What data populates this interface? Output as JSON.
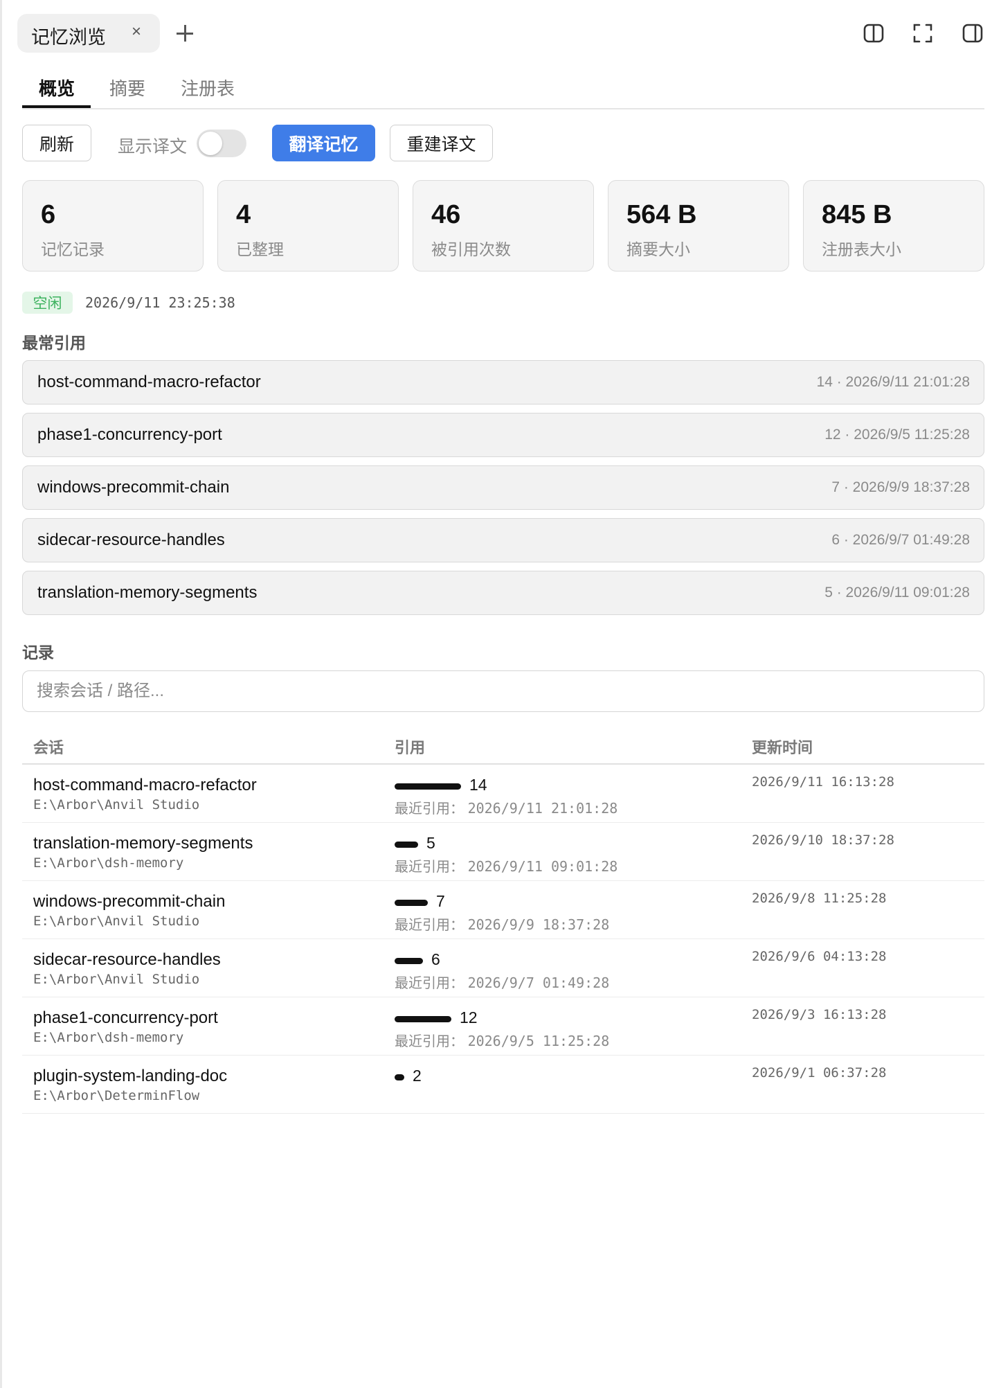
{
  "tab": {
    "label": "记忆浏览",
    "close": "×"
  },
  "nav": [
    "概览",
    "摘要",
    "注册表"
  ],
  "toolbar": {
    "refresh": "刷新",
    "show_translation": "显示译文",
    "translate": "翻译记忆",
    "rebuild": "重建译文",
    "toggle_on": false
  },
  "stats": [
    {
      "value": "6",
      "label": "记忆记录"
    },
    {
      "value": "4",
      "label": "已整理"
    },
    {
      "value": "46",
      "label": "被引用次数"
    },
    {
      "value": "564 B",
      "label": "摘要大小"
    },
    {
      "value": "845 B",
      "label": "注册表大小"
    }
  ],
  "status": {
    "badge": "空闲",
    "time": "2026/9/11 23:25:38",
    "badge_color": "#3cb25e"
  },
  "frequent": {
    "title": "最常引用",
    "items": [
      {
        "name": "host-command-macro-refactor",
        "meta": "14 · 2026/9/11 21:01:28"
      },
      {
        "name": "phase1-concurrency-port",
        "meta": "12 · 2026/9/5 11:25:28"
      },
      {
        "name": "windows-precommit-chain",
        "meta": "7 · 2026/9/9 18:37:28"
      },
      {
        "name": "sidecar-resource-handles",
        "meta": "6 · 2026/9/7 01:49:28"
      },
      {
        "name": "translation-memory-segments",
        "meta": "5 · 2026/9/11 09:01:28"
      }
    ]
  },
  "records": {
    "title": "记录",
    "search_placeholder": "搜索会话 / 路径...",
    "columns": [
      "会话",
      "引用",
      "更新时间"
    ],
    "last_ref_label": "最近引用：",
    "rows": [
      {
        "name": "host-command-macro-refactor",
        "path": "E:\\Arbor\\Anvil Studio",
        "refs": 14,
        "last_ref": "2026/9/11 21:01:28",
        "updated": "2026/9/11 16:13:28"
      },
      {
        "name": "translation-memory-segments",
        "path": "E:\\Arbor\\dsh-memory",
        "refs": 5,
        "last_ref": "2026/9/11 09:01:28",
        "updated": "2026/9/10 18:37:28"
      },
      {
        "name": "windows-precommit-chain",
        "path": "E:\\Arbor\\Anvil Studio",
        "refs": 7,
        "last_ref": "2026/9/9 18:37:28",
        "updated": "2026/9/8 11:25:28"
      },
      {
        "name": "sidecar-resource-handles",
        "path": "E:\\Arbor\\Anvil Studio",
        "refs": 6,
        "last_ref": "2026/9/7 01:49:28",
        "updated": "2026/9/6 04:13:28"
      },
      {
        "name": "phase1-concurrency-port",
        "path": "E:\\Arbor\\dsh-memory",
        "refs": 12,
        "last_ref": "2026/9/5 11:25:28",
        "updated": "2026/9/3 16:13:28"
      },
      {
        "name": "plugin-system-landing-doc",
        "path": "E:\\Arbor\\DeterminFlow",
        "refs": 2,
        "last_ref": null,
        "updated": "2026/9/1 06:37:28"
      }
    ]
  },
  "colors": {
    "accent": "#3f7de8",
    "bar": "#111111"
  },
  "icons": [
    "close-icon",
    "plus-icon",
    "split-view-icon",
    "fullscreen-icon",
    "sidebar-right-icon"
  ]
}
